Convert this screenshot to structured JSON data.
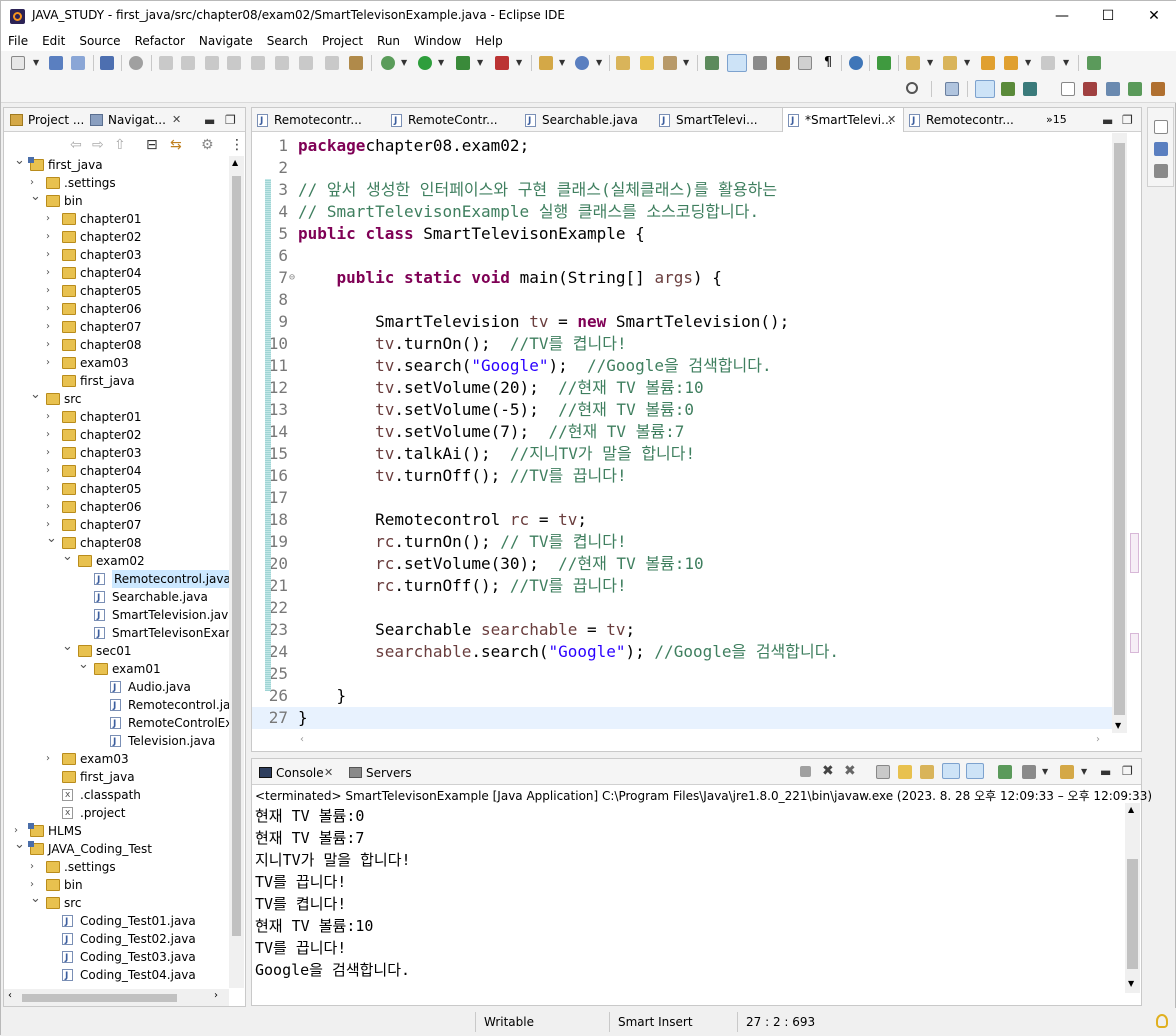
{
  "window": {
    "title": "JAVA_STUDY - first_java/src/chapter08/exam02/SmartTelevisonExample.java - Eclipse IDE",
    "minimize": "—",
    "maximize": "☐",
    "close": "✕"
  },
  "menu": [
    "File",
    "Edit",
    "Source",
    "Refactor",
    "Navigate",
    "Search",
    "Project",
    "Run",
    "Window",
    "Help"
  ],
  "left_panel": {
    "tabs": [
      {
        "label": "Project ..."
      },
      {
        "label": "Navigat...",
        "close": "✕"
      }
    ],
    "tree": [
      {
        "label": "first_java",
        "type": "project",
        "depth": 0,
        "arrow": "expanded"
      },
      {
        "label": ".settings",
        "type": "folder",
        "depth": 1,
        "arrow": "collapsed"
      },
      {
        "label": "bin",
        "type": "folder",
        "depth": 1,
        "arrow": "expanded"
      },
      {
        "label": "chapter01",
        "type": "folder",
        "depth": 2,
        "arrow": "collapsed"
      },
      {
        "label": "chapter02",
        "type": "folder",
        "depth": 2,
        "arrow": "collapsed"
      },
      {
        "label": "chapter03",
        "type": "folder",
        "depth": 2,
        "arrow": "collapsed"
      },
      {
        "label": "chapter04",
        "type": "folder",
        "depth": 2,
        "arrow": "collapsed"
      },
      {
        "label": "chapter05",
        "type": "folder",
        "depth": 2,
        "arrow": "collapsed"
      },
      {
        "label": "chapter06",
        "type": "folder",
        "depth": 2,
        "arrow": "collapsed"
      },
      {
        "label": "chapter07",
        "type": "folder",
        "depth": 2,
        "arrow": "collapsed"
      },
      {
        "label": "chapter08",
        "type": "folder",
        "depth": 2,
        "arrow": "collapsed"
      },
      {
        "label": "exam03",
        "type": "folder",
        "depth": 2,
        "arrow": "collapsed"
      },
      {
        "label": "first_java",
        "type": "folder",
        "depth": 2,
        "arrow": "none"
      },
      {
        "label": "src",
        "type": "folder",
        "depth": 1,
        "arrow": "expanded"
      },
      {
        "label": "chapter01",
        "type": "folder",
        "depth": 2,
        "arrow": "collapsed"
      },
      {
        "label": "chapter02",
        "type": "folder",
        "depth": 2,
        "arrow": "collapsed"
      },
      {
        "label": "chapter03",
        "type": "folder",
        "depth": 2,
        "arrow": "collapsed"
      },
      {
        "label": "chapter04",
        "type": "folder",
        "depth": 2,
        "arrow": "collapsed"
      },
      {
        "label": "chapter05",
        "type": "folder",
        "depth": 2,
        "arrow": "collapsed"
      },
      {
        "label": "chapter06",
        "type": "folder",
        "depth": 2,
        "arrow": "collapsed"
      },
      {
        "label": "chapter07",
        "type": "folder",
        "depth": 2,
        "arrow": "collapsed"
      },
      {
        "label": "chapter08",
        "type": "folder",
        "depth": 2,
        "arrow": "expanded"
      },
      {
        "label": "exam02",
        "type": "folder",
        "depth": 3,
        "arrow": "expanded"
      },
      {
        "label": "Remotecontrol.java",
        "type": "java",
        "depth": 4,
        "arrow": "none",
        "selected": true
      },
      {
        "label": "Searchable.java",
        "type": "java",
        "depth": 4,
        "arrow": "none"
      },
      {
        "label": "SmartTelevision.java",
        "type": "java",
        "depth": 4,
        "arrow": "none"
      },
      {
        "label": "SmartTelevisonExamp",
        "type": "java",
        "depth": 4,
        "arrow": "none"
      },
      {
        "label": "sec01",
        "type": "folder",
        "depth": 3,
        "arrow": "expanded"
      },
      {
        "label": "exam01",
        "type": "folder",
        "depth": 4,
        "arrow": "expanded"
      },
      {
        "label": "Audio.java",
        "type": "java",
        "depth": 5,
        "arrow": "none"
      },
      {
        "label": "Remotecontrol.java",
        "type": "java",
        "depth": 5,
        "arrow": "none"
      },
      {
        "label": "RemoteControlExa",
        "type": "java",
        "depth": 5,
        "arrow": "none"
      },
      {
        "label": "Television.java",
        "type": "java",
        "depth": 5,
        "arrow": "none"
      },
      {
        "label": "exam03",
        "type": "folder",
        "depth": 2,
        "arrow": "collapsed"
      },
      {
        "label": "first_java",
        "type": "folder",
        "depth": 2,
        "arrow": "none"
      },
      {
        "label": ".classpath",
        "type": "xml",
        "depth": 2,
        "arrow": "none"
      },
      {
        "label": ".project",
        "type": "xml",
        "depth": 2,
        "arrow": "none"
      },
      {
        "label": "HLMS",
        "type": "project",
        "depth": 0,
        "arrow": "collapsed"
      },
      {
        "label": "JAVA_Coding_Test",
        "type": "project",
        "depth": 0,
        "arrow": "expanded"
      },
      {
        "label": ".settings",
        "type": "folder",
        "depth": 1,
        "arrow": "collapsed"
      },
      {
        "label": "bin",
        "type": "folder",
        "depth": 1,
        "arrow": "collapsed"
      },
      {
        "label": "src",
        "type": "folder",
        "depth": 1,
        "arrow": "expanded"
      },
      {
        "label": "Coding_Test01.java",
        "type": "java",
        "depth": 2,
        "arrow": "none"
      },
      {
        "label": "Coding_Test02.java",
        "type": "java",
        "depth": 2,
        "arrow": "none"
      },
      {
        "label": "Coding_Test03.java",
        "type": "java",
        "depth": 2,
        "arrow": "none"
      },
      {
        "label": "Coding_Test04.java",
        "type": "java",
        "depth": 2,
        "arrow": "none"
      }
    ]
  },
  "editor": {
    "tabs": [
      {
        "label": "Remotecontr..."
      },
      {
        "label": "RemoteContr..."
      },
      {
        "label": "Searchable.java"
      },
      {
        "label": "SmartTelevi..."
      },
      {
        "label": "*SmartTelevi...",
        "active": true,
        "close": "✕"
      },
      {
        "label": "Remotecontr..."
      }
    ],
    "overflow": "»15",
    "lines": [
      "1",
      "2",
      "3",
      "4",
      "5",
      "6",
      "7",
      "8",
      "9",
      "10",
      "11",
      "12",
      "13",
      "14",
      "15",
      "16",
      "17",
      "18",
      "19",
      "20",
      "21",
      "22",
      "23",
      "24",
      "25",
      "26",
      "27"
    ],
    "code": [
      [
        [
          "kw",
          "package"
        ],
        [
          "",
          "chapter08.exam02;"
        ]
      ],
      [],
      [
        [
          "cm",
          "// 앞서 생성한 인터페이스와 구현 클래스(실체클래스)를 활용하는"
        ]
      ],
      [
        [
          "cm",
          "// SmartTelevisonExample 실행 클래스를 소스코딩합니다."
        ]
      ],
      [
        [
          "kw",
          "public"
        ],
        [
          "",
          " "
        ],
        [
          "kw",
          "class"
        ],
        [
          "",
          " SmartTelevisonExample {"
        ]
      ],
      [],
      [
        [
          "",
          "    "
        ],
        [
          "kw",
          "public"
        ],
        [
          "",
          " "
        ],
        [
          "kw",
          "static"
        ],
        [
          "",
          " "
        ],
        [
          "kw",
          "void"
        ],
        [
          "",
          " main(String[] "
        ],
        [
          "fv",
          "args"
        ],
        [
          "",
          ") {"
        ]
      ],
      [],
      [
        [
          "",
          "        SmartTelevision "
        ],
        [
          "fv",
          "tv"
        ],
        [
          "",
          " = "
        ],
        [
          "kw",
          "new"
        ],
        [
          "",
          " SmartTelevision();"
        ]
      ],
      [
        [
          "",
          "        "
        ],
        [
          "fv",
          "tv"
        ],
        [
          "",
          ".turnOn();  "
        ],
        [
          "cm",
          "//TV를 켭니다!"
        ]
      ],
      [
        [
          "",
          "        "
        ],
        [
          "fv",
          "tv"
        ],
        [
          "",
          ".search("
        ],
        [
          "st",
          "\"Google\""
        ],
        [
          "",
          ");  "
        ],
        [
          "cm",
          "//Google을 검색합니다."
        ]
      ],
      [
        [
          "",
          "        "
        ],
        [
          "fv",
          "tv"
        ],
        [
          "",
          ".setVolume(20);  "
        ],
        [
          "cm",
          "//현재 TV 볼륨:10"
        ]
      ],
      [
        [
          "",
          "        "
        ],
        [
          "fv",
          "tv"
        ],
        [
          "",
          ".setVolume(-5);  "
        ],
        [
          "cm",
          "//현재 TV 볼륨:0"
        ]
      ],
      [
        [
          "",
          "        "
        ],
        [
          "fv",
          "tv"
        ],
        [
          "",
          ".setVolume(7);  "
        ],
        [
          "cm",
          "//현재 TV 볼륨:7"
        ]
      ],
      [
        [
          "",
          "        "
        ],
        [
          "fv",
          "tv"
        ],
        [
          "",
          ".talkAi();  "
        ],
        [
          "cm",
          "//지니TV가 말을 합니다!"
        ]
      ],
      [
        [
          "",
          "        "
        ],
        [
          "fv",
          "tv"
        ],
        [
          "",
          ".turnOff(); "
        ],
        [
          "cm",
          "//TV를 끕니다!"
        ]
      ],
      [],
      [
        [
          "",
          "        Remotecontrol "
        ],
        [
          "fv",
          "rc"
        ],
        [
          "",
          " = "
        ],
        [
          "fv",
          "tv"
        ],
        [
          "",
          ";"
        ]
      ],
      [
        [
          "",
          "        "
        ],
        [
          "fv",
          "rc"
        ],
        [
          "",
          ".turnOn(); "
        ],
        [
          "cm",
          "// TV를 켭니다!"
        ]
      ],
      [
        [
          "",
          "        "
        ],
        [
          "fv",
          "rc"
        ],
        [
          "",
          ".setVolume(30);  "
        ],
        [
          "cm",
          "//현재 TV 볼륨:10"
        ]
      ],
      [
        [
          "",
          "        "
        ],
        [
          "fv",
          "rc"
        ],
        [
          "",
          ".turnOff(); "
        ],
        [
          "cm",
          "//TV를 끕니다!"
        ]
      ],
      [],
      [
        [
          "",
          "        Searchable "
        ],
        [
          "fv",
          "searchable"
        ],
        [
          "",
          " = "
        ],
        [
          "fv",
          "tv"
        ],
        [
          "",
          ";"
        ]
      ],
      [
        [
          "",
          "        "
        ],
        [
          "fv",
          "searchable"
        ],
        [
          "",
          ".search("
        ],
        [
          "st",
          "\"Google\""
        ],
        [
          "",
          "); "
        ],
        [
          "cm",
          "//Google을 검색합니다."
        ]
      ],
      [],
      [
        [
          "",
          "    }"
        ]
      ],
      [
        [
          "",
          "}"
        ]
      ]
    ]
  },
  "console": {
    "tabs": [
      {
        "label": "Console",
        "close": "✕"
      },
      {
        "label": "Servers"
      }
    ],
    "header": "<terminated> SmartTelevisonExample [Java Application] C:\\Program Files\\Java\\jre1.8.0_221\\bin\\javaw.exe  (2023. 8. 28 오후 12:09:33 – 오후 12:09:33)",
    "output": [
      "현재 TV 볼륨:0",
      "현재 TV 볼륨:7",
      "지니TV가 말을 합니다!",
      "TV를 끕니다!",
      "TV를 켭니다!",
      "현재 TV 볼륨:10",
      "TV를 끕니다!",
      "Google을 검색합니다."
    ]
  },
  "status": {
    "mode": "Writable",
    "insert": "Smart Insert",
    "position": "27 : 2 : 693"
  },
  "colors": {
    "keyword": "#7f0055",
    "comment": "#3f7f5f",
    "string": "#2a00ff",
    "field": "#6a3e3e",
    "selection": "#cce8ff",
    "current_line": "#e8f2fe"
  }
}
